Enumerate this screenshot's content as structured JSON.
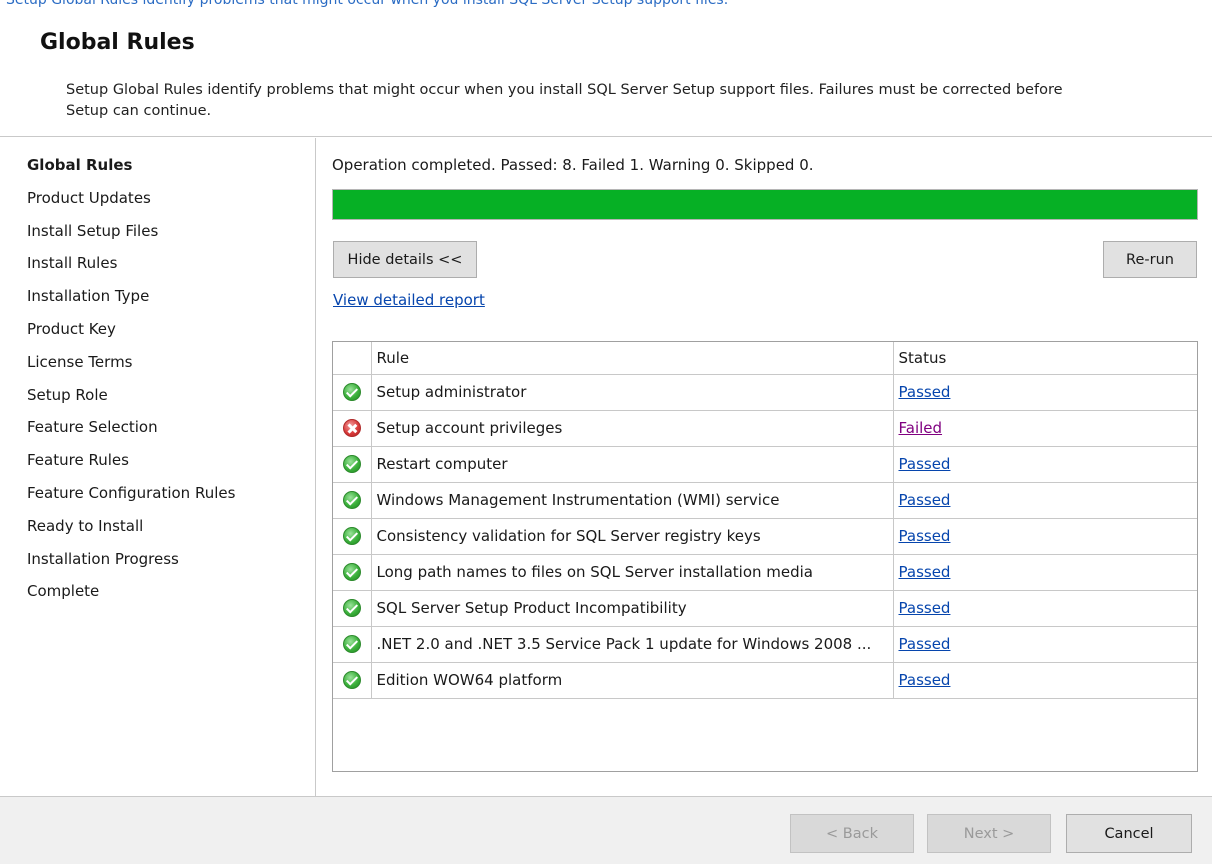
{
  "window": {
    "top_cut_text": "Setup Global Rules identify problems that might occur when you install SQL Server Setup support files."
  },
  "header": {
    "title": "Global Rules",
    "description": "Setup Global Rules identify problems that might occur when you install SQL Server Setup support files. Failures must be corrected before Setup can continue."
  },
  "sidebar": {
    "items": [
      {
        "label": "Global Rules",
        "active": true
      },
      {
        "label": "Product Updates"
      },
      {
        "label": "Install Setup Files"
      },
      {
        "label": "Install Rules"
      },
      {
        "label": "Installation Type"
      },
      {
        "label": "Product Key"
      },
      {
        "label": "License Terms"
      },
      {
        "label": "Setup Role"
      },
      {
        "label": "Feature Selection"
      },
      {
        "label": "Feature Rules"
      },
      {
        "label": "Feature Configuration Rules"
      },
      {
        "label": "Ready to Install"
      },
      {
        "label": "Installation Progress"
      },
      {
        "label": "Complete"
      }
    ]
  },
  "main": {
    "status_text": "Operation completed. Passed: 8.   Failed 1.   Warning 0.   Skipped 0.",
    "progress_percent": 100,
    "progress_color": "#06b025",
    "hide_details_label": "Hide details <<",
    "rerun_label": "Re-run",
    "view_report_label": "View detailed report",
    "table": {
      "headers": [
        "",
        "Rule",
        "Status"
      ],
      "rows": [
        {
          "icon": "check-icon",
          "rule": "Setup administrator",
          "status": "Passed"
        },
        {
          "icon": "error-icon",
          "rule": "Setup account privileges",
          "status": "Failed"
        },
        {
          "icon": "check-icon",
          "rule": "Restart computer",
          "status": "Passed"
        },
        {
          "icon": "check-icon",
          "rule": "Windows Management Instrumentation (WMI) service",
          "status": "Passed"
        },
        {
          "icon": "check-icon",
          "rule": "Consistency validation for SQL Server registry keys",
          "status": "Passed"
        },
        {
          "icon": "check-icon",
          "rule": "Long path names to files on SQL Server installation media",
          "status": "Passed"
        },
        {
          "icon": "check-icon",
          "rule": "SQL Server Setup Product Incompatibility",
          "status": "Passed"
        },
        {
          "icon": "check-icon",
          "rule": ".NET 2.0 and .NET 3.5 Service Pack 1 update for Windows 2008 ...",
          "status": "Passed"
        },
        {
          "icon": "check-icon",
          "rule": "Edition WOW64 platform",
          "status": "Passed"
        }
      ]
    }
  },
  "footer": {
    "back_label": "< Back",
    "next_label": "Next >",
    "cancel_label": "Cancel"
  }
}
